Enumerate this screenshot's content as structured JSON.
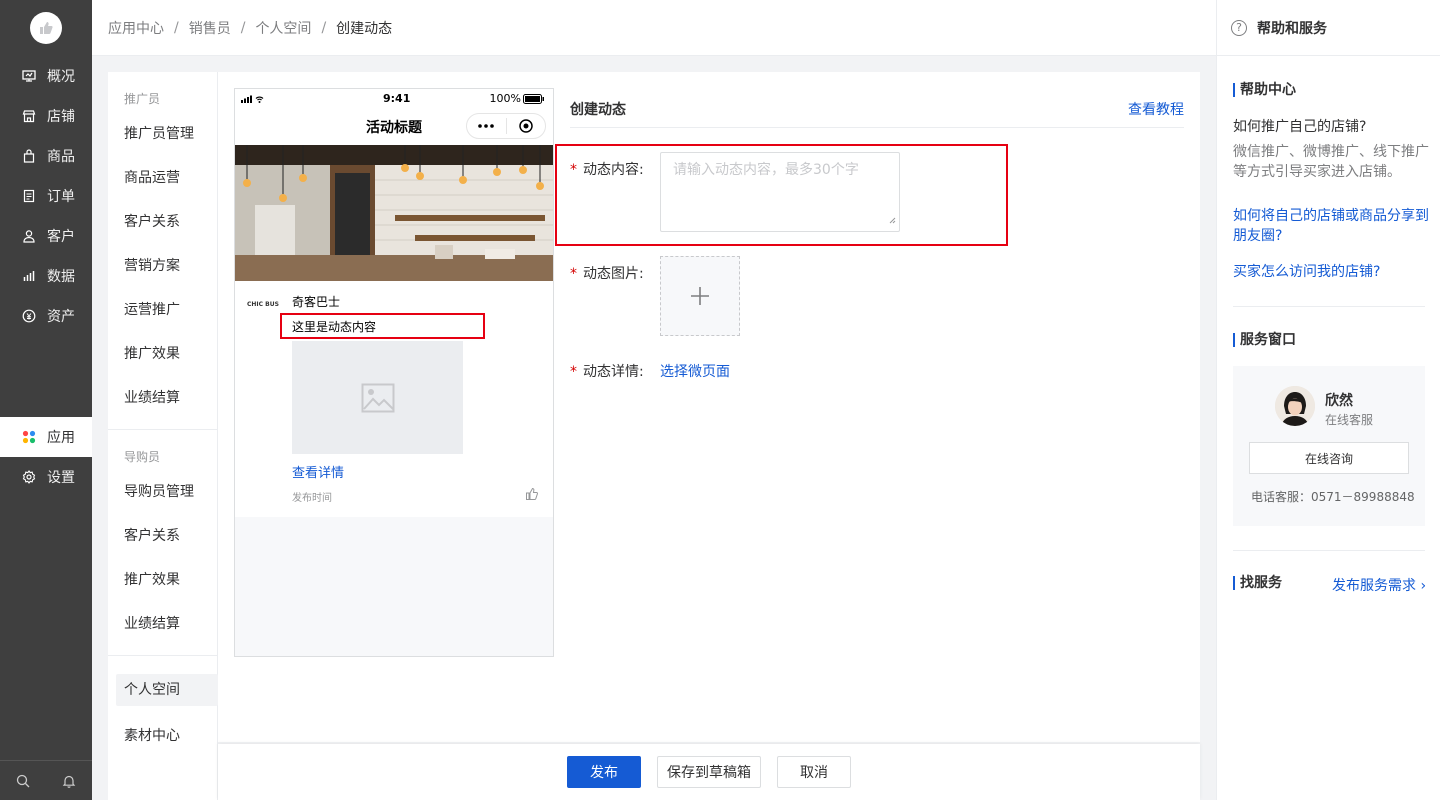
{
  "nav": {
    "items": [
      {
        "label": "概况",
        "icon": "overview-icon"
      },
      {
        "label": "店铺",
        "icon": "store-icon"
      },
      {
        "label": "商品",
        "icon": "goods-icon"
      },
      {
        "label": "订单",
        "icon": "order-icon"
      },
      {
        "label": "客户",
        "icon": "customer-icon"
      },
      {
        "label": "数据",
        "icon": "data-icon"
      },
      {
        "label": "资产",
        "icon": "asset-icon"
      },
      {
        "label": "应用",
        "icon": "apps-icon"
      },
      {
        "label": "设置",
        "icon": "settings-icon"
      }
    ],
    "active": "应用"
  },
  "breadcrumb": [
    "应用中心",
    "销售员",
    "个人空间",
    "创建动态"
  ],
  "subnav": {
    "group1": "推广员",
    "group1_items": [
      "推广员管理",
      "商品运营",
      "客户关系",
      "营销方案",
      "运营推广",
      "推广效果",
      "业绩结算"
    ],
    "group2": "导购员",
    "group2_items": [
      "导购员管理",
      "客户关系",
      "推广效果",
      "业绩结算"
    ],
    "group3_items": [
      "个人空间",
      "素材中心"
    ]
  },
  "phone": {
    "time": "9:41",
    "battery": "100%",
    "title": "活动标题",
    "brand": "CHIC BUS",
    "shop_name": "奇客巴士",
    "content": "这里是动态内容",
    "detail_link": "查看详情",
    "publish_time": "发布时间"
  },
  "form": {
    "title": "创建动态",
    "tutorial": "查看教程",
    "content_label": "动态内容:",
    "content_placeholder": "请输入动态内容，最多30个字",
    "image_label": "动态图片:",
    "detail_label": "动态详情:",
    "choose_page": "选择微页面"
  },
  "footer": {
    "publish": "发布",
    "save_draft": "保存到草稿箱",
    "cancel": "取消"
  },
  "help": {
    "title": "帮助和服务",
    "center_title": "帮助中心",
    "q1": "如何推广自己的店铺?",
    "a1": "微信推广、微博推广、线下推广等方式引导买家进入店铺。",
    "link1": "如何将自己的店铺或商品分享到朋友圈?",
    "link2": "买家怎么访问我的店铺?",
    "service_title": "服务窗口",
    "agent_name": "欣然",
    "agent_role": "在线客服",
    "consult": "在线咨询",
    "phone": "电话客服：0571－89988848",
    "find_service": "找服务",
    "publish_demand": "发布服务需求 ›"
  },
  "colors": {
    "primary": "#155bd4",
    "highlight": "#e60012",
    "nav_bg": "#3f3f3f"
  }
}
